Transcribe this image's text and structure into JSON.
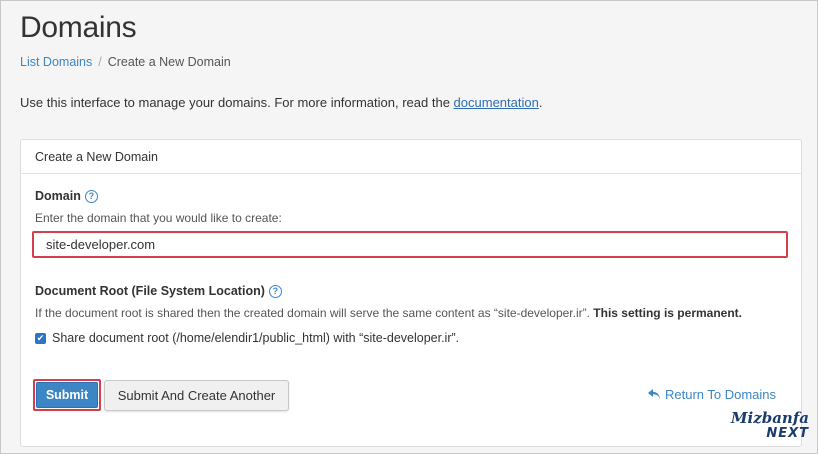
{
  "header": {
    "title": "Domains",
    "breadcrumb": {
      "parent": "List Domains",
      "separator": "/",
      "current": "Create a New Domain"
    }
  },
  "intro": {
    "text": "Use this interface to manage your domains. For more information, read the ",
    "link": "documentation",
    "end": "."
  },
  "panel": {
    "heading": "Create a New Domain",
    "domain": {
      "label": "Domain",
      "hint": "Enter the domain that you would like to create:",
      "value": "site-developer.com"
    },
    "docroot": {
      "label": "Document Root (File System Location)",
      "hint": "If the document root is shared then the created domain will serve the same content as “site-developer.ir”. ",
      "hint_bold": "This setting is permanent.",
      "share_label": "Share document root (/home/elendir1/public_html) with “site-developer.ir”.",
      "share_checked": true
    },
    "buttons": {
      "submit": "Submit",
      "submit_another": "Submit And Create Another",
      "return_link": "Return To Domains"
    }
  },
  "logo": {
    "main": "Mizbanfa",
    "sub": "NEXT"
  },
  "colors": {
    "accent": "#3c86c6",
    "highlight_border": "#d2404d"
  }
}
